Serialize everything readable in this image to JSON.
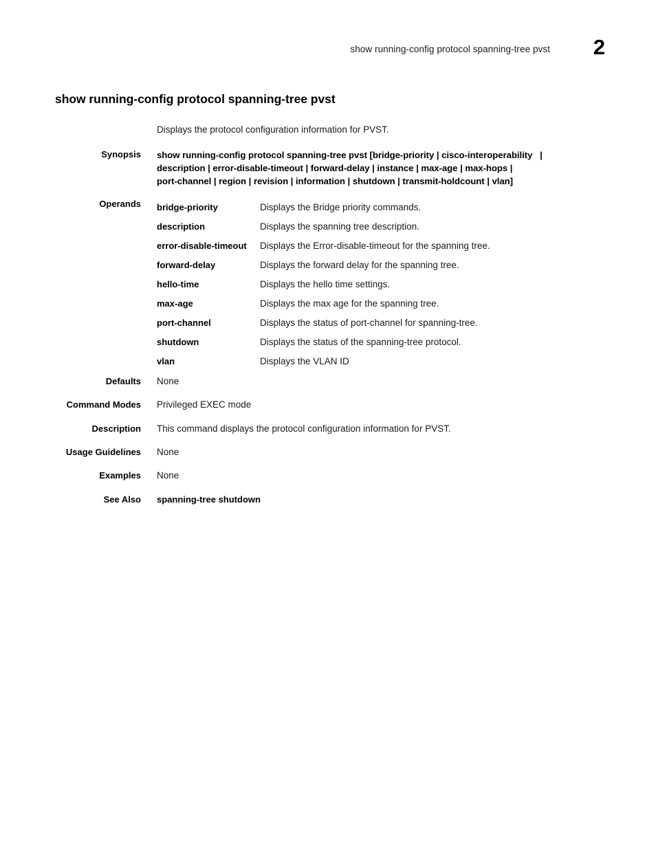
{
  "header": {
    "running_title": "show running-config protocol spanning-tree pvst",
    "page_number": "2"
  },
  "command": {
    "title": "show running-config protocol spanning-tree pvst",
    "intro": "Displays the protocol configuration information for PVST."
  },
  "labels": {
    "synopsis": "Synopsis",
    "operands": "Operands",
    "defaults": "Defaults",
    "command_modes": "Command Modes",
    "description": "Description",
    "usage_guidelines": "Usage Guidelines",
    "examples": "Examples",
    "see_also": "See Also"
  },
  "synopsis": {
    "line1": "show running-config protocol spanning-tree pvst [bridge-priority | cisco-interoperability   |",
    "line2": "description | error-disable-timeout | forward-delay | instance | max-age | max-hops |",
    "line3": "port-channel | region | revision | information | shutdown | transmit-holdcount | vlan]"
  },
  "operands": [
    {
      "term": "bridge-priority",
      "desc": "Displays the Bridge priority commands."
    },
    {
      "term": "description",
      "desc": "Displays the spanning tree description."
    },
    {
      "term": "error-disable-timeout",
      "desc": "Displays the Error-disable-timeout for the spanning tree."
    },
    {
      "term": "forward-delay",
      "desc": "Displays the forward delay for the spanning tree."
    },
    {
      "term": "hello-time",
      "desc": "Displays the hello time settings."
    },
    {
      "term": "max-age",
      "desc": "Displays the max age for the spanning tree."
    },
    {
      "term": "port-channel",
      "desc": "Displays the status of port-channel for spanning-tree."
    },
    {
      "term": "shutdown",
      "desc": "Displays the status of the spanning-tree protocol."
    },
    {
      "term": "vlan",
      "desc": "Displays the VLAN ID"
    }
  ],
  "values": {
    "defaults": "None",
    "command_modes": "Privileged EXEC mode",
    "description": "This command displays the protocol configuration information for PVST.",
    "usage_guidelines": "None",
    "examples": "None",
    "see_also": "spanning-tree shutdown"
  }
}
